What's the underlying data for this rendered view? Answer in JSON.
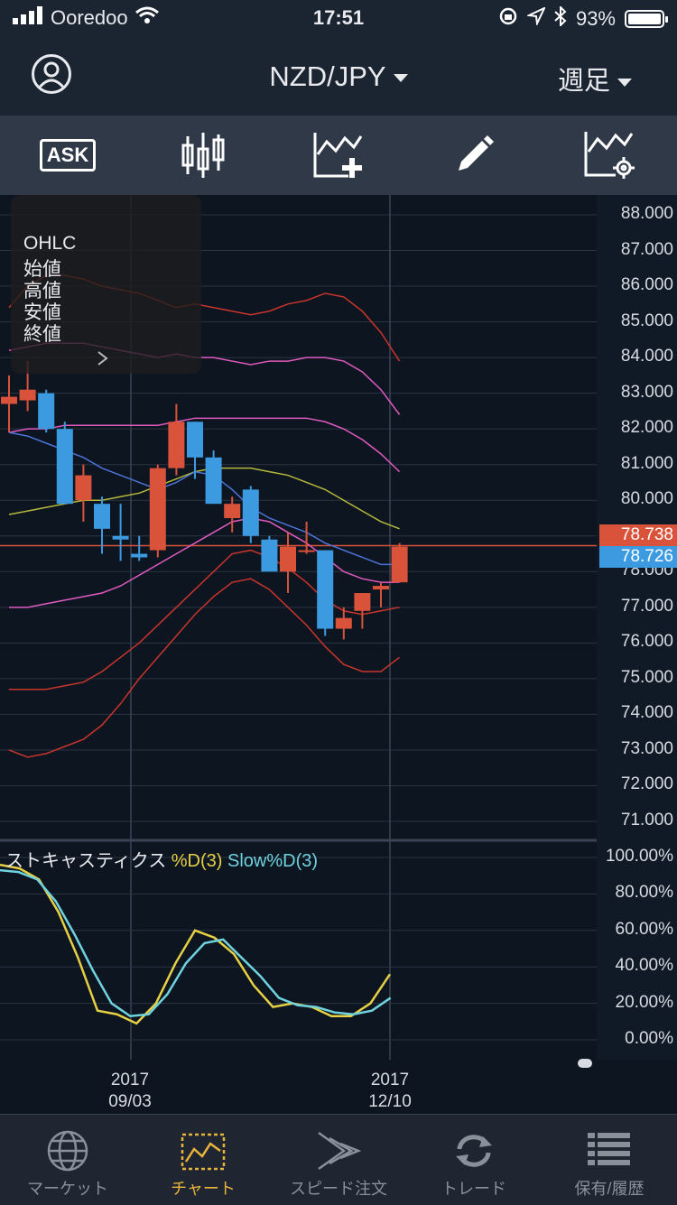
{
  "status_bar": {
    "carrier": "Ooredoo",
    "time": "17:51",
    "battery": "93%",
    "battery_level": 0.93
  },
  "nav": {
    "pair": "NZD/JPY",
    "period": "週足"
  },
  "toolbar": {
    "ask_label": "ASK"
  },
  "ohlc_panel": {
    "lines": [
      "OHLC",
      "始値",
      "高値",
      "安値",
      "終値"
    ]
  },
  "price_axis": [
    "88.000",
    "87.000",
    "86.000",
    "85.000",
    "84.000",
    "83.000",
    "82.000",
    "81.000",
    "80.000",
    "78.000",
    "77.000",
    "76.000",
    "75.000",
    "74.000",
    "73.000",
    "72.000",
    "71.000"
  ],
  "price_tags": {
    "bid": "78.738",
    "ask": "78.726",
    "bid_color": "#d9533b",
    "ask_color": "#3c9be0"
  },
  "indicator": {
    "name": "ストキャスティクス",
    "series1": "%D(3)",
    "series2": "Slow%D(3)",
    "series1_color": "#e6d044",
    "series2_color": "#6ed3de"
  },
  "stoch_axis": [
    "100.00%",
    "80.00%",
    "60.00%",
    "40.00%",
    "20.00%",
    "0.00%"
  ],
  "dates": [
    {
      "year": "2017",
      "date": "09/03"
    },
    {
      "year": "2017",
      "date": "12/10"
    }
  ],
  "tabs": [
    {
      "label": "マーケット",
      "icon": "globe-icon"
    },
    {
      "label": "チャート",
      "icon": "chart-icon",
      "active": true
    },
    {
      "label": "スピード注文",
      "icon": "speed-order-icon"
    },
    {
      "label": "トレード",
      "icon": "refresh-icon"
    },
    {
      "label": "保有/履歴",
      "icon": "list-icon"
    }
  ],
  "chart_data": {
    "type": "candlestick",
    "pair": "NZD/JPY",
    "timeframe": "週足",
    "ylim": [
      70.5,
      88.5
    ],
    "candles": [
      {
        "o": 82.7,
        "h": 83.5,
        "l": 81.9,
        "c": 82.9
      },
      {
        "o": 82.8,
        "h": 83.9,
        "l": 82.5,
        "c": 83.1
      },
      {
        "o": 83.0,
        "h": 83.1,
        "l": 81.9,
        "c": 82.0
      },
      {
        "o": 82.0,
        "h": 82.2,
        "l": 79.9,
        "c": 79.9
      },
      {
        "o": 80.0,
        "h": 81.0,
        "l": 79.4,
        "c": 80.7
      },
      {
        "o": 79.9,
        "h": 80.1,
        "l": 78.5,
        "c": 79.2
      },
      {
        "o": 79.0,
        "h": 79.9,
        "l": 78.3,
        "c": 78.9
      },
      {
        "o": 78.5,
        "h": 79.0,
        "l": 78.3,
        "c": 78.4
      },
      {
        "o": 78.6,
        "h": 81.0,
        "l": 78.4,
        "c": 80.9
      },
      {
        "o": 80.9,
        "h": 82.7,
        "l": 80.7,
        "c": 82.2
      },
      {
        "o": 82.2,
        "h": 82.2,
        "l": 80.6,
        "c": 81.2
      },
      {
        "o": 81.2,
        "h": 81.4,
        "l": 79.9,
        "c": 79.9
      },
      {
        "o": 79.5,
        "h": 80.1,
        "l": 79.1,
        "c": 79.9
      },
      {
        "o": 80.3,
        "h": 80.4,
        "l": 78.8,
        "c": 79.0
      },
      {
        "o": 78.9,
        "h": 79.0,
        "l": 78.0,
        "c": 78.0
      },
      {
        "o": 78.0,
        "h": 79.1,
        "l": 77.4,
        "c": 78.7
      },
      {
        "o": 78.6,
        "h": 79.4,
        "l": 78.5,
        "c": 78.6
      },
      {
        "o": 78.6,
        "h": 78.6,
        "l": 76.2,
        "c": 76.4
      },
      {
        "o": 76.4,
        "h": 77.0,
        "l": 76.1,
        "c": 76.7
      },
      {
        "o": 76.9,
        "h": 77.4,
        "l": 76.4,
        "c": 77.4
      },
      {
        "o": 77.5,
        "h": 77.7,
        "l": 77.0,
        "c": 77.6
      },
      {
        "o": 77.7,
        "h": 78.8,
        "l": 77.7,
        "c": 78.7
      }
    ],
    "bands": {
      "outer_upper": [
        85.4,
        86.0,
        86.3,
        86.3,
        86.2,
        86.0,
        85.9,
        85.8,
        85.6,
        85.4,
        85.5,
        85.4,
        85.3,
        85.2,
        85.3,
        85.5,
        85.6,
        85.8,
        85.7,
        85.3,
        84.7,
        83.9
      ],
      "mid_upper": [
        84.2,
        84.3,
        84.4,
        84.4,
        84.4,
        84.3,
        84.2,
        84.1,
        84.0,
        84.1,
        84.0,
        84.0,
        83.9,
        83.8,
        83.9,
        83.9,
        84.0,
        84.0,
        83.9,
        83.6,
        83.1,
        82.4
      ],
      "inner_upper": [
        81.9,
        82.0,
        82.0,
        82.1,
        82.1,
        82.1,
        82.1,
        82.1,
        82.1,
        82.2,
        82.3,
        82.3,
        82.3,
        82.3,
        82.3,
        82.3,
        82.3,
        82.2,
        82.0,
        81.7,
        81.3,
        80.8
      ],
      "mid_line": [
        79.6,
        79.7,
        79.8,
        79.9,
        80.0,
        80.0,
        80.1,
        80.2,
        80.4,
        80.6,
        80.8,
        80.9,
        80.9,
        80.9,
        80.8,
        80.7,
        80.5,
        80.3,
        80.0,
        79.7,
        79.4,
        79.2
      ],
      "sma_blue": [
        81.9,
        81.8,
        81.6,
        81.4,
        81.2,
        80.9,
        80.7,
        80.5,
        80.3,
        80.5,
        80.8,
        80.7,
        80.3,
        79.8,
        79.5,
        79.3,
        79.1,
        78.8,
        78.6,
        78.4,
        78.2,
        78.2
      ],
      "inner_lower": [
        77.0,
        77.0,
        77.1,
        77.2,
        77.3,
        77.4,
        77.6,
        77.9,
        78.2,
        78.5,
        78.8,
        79.1,
        79.4,
        79.5,
        79.4,
        79.1,
        78.8,
        78.4,
        78.0,
        77.8,
        77.7,
        77.7
      ],
      "mid_lower": [
        74.7,
        74.7,
        74.7,
        74.8,
        74.9,
        75.2,
        75.6,
        76.0,
        76.5,
        77.0,
        77.5,
        78.0,
        78.5,
        78.6,
        78.4,
        78.1,
        77.7,
        77.2,
        76.9,
        76.8,
        76.9,
        77.0
      ],
      "outer_lower": [
        73.0,
        72.8,
        72.9,
        73.1,
        73.3,
        73.7,
        74.3,
        75.0,
        75.6,
        76.2,
        76.8,
        77.3,
        77.7,
        77.8,
        77.5,
        77.0,
        76.5,
        75.9,
        75.4,
        75.2,
        75.2,
        75.6
      ]
    },
    "stochastic": {
      "d": [
        96,
        94,
        88,
        70,
        45,
        16,
        14,
        9,
        20,
        42,
        60,
        56,
        47,
        30,
        18,
        20,
        18,
        13,
        13,
        20,
        36
      ],
      "slow_d": [
        93,
        92,
        88,
        76,
        58,
        38,
        20,
        13,
        14,
        25,
        42,
        53,
        55,
        45,
        35,
        23,
        19,
        18,
        15,
        14,
        16,
        23
      ]
    }
  }
}
